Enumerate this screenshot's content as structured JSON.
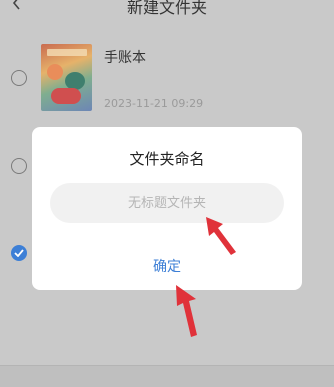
{
  "header": {
    "title": "新建文件夹",
    "back_icon": "back-chevron-icon"
  },
  "list": {
    "items": [
      {
        "title": "手账本",
        "date": "2023-11-21 09:29",
        "selected": false
      },
      {
        "selected": false
      },
      {
        "selected": true
      }
    ]
  },
  "dialog": {
    "title": "文件夹命名",
    "input_value": "",
    "input_placeholder": "无标题文件夹",
    "confirm_label": "确定"
  },
  "colors": {
    "accent": "#3d7fd6",
    "annotation_arrow": "#e0323a",
    "overlay": "#c9c9c9"
  },
  "icons": {
    "check": "check-icon",
    "arrow": "annotation-arrow-icon"
  }
}
